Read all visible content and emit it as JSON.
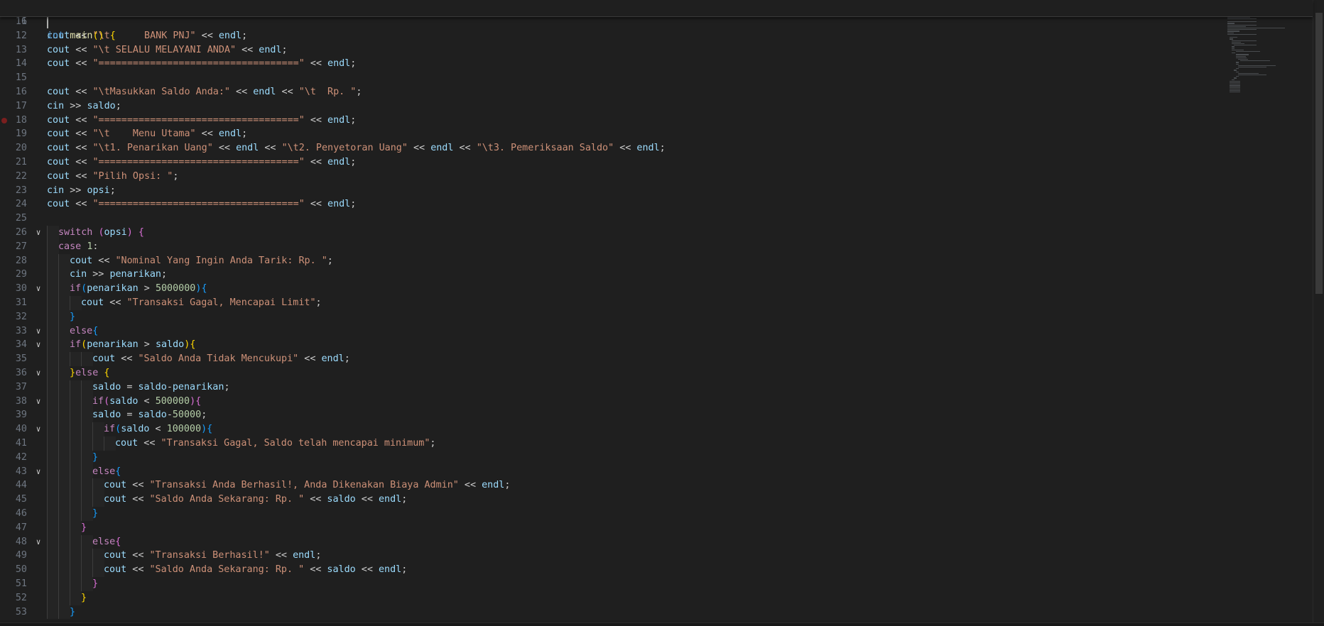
{
  "colors": {
    "background": "#1f1f1f",
    "line_number": "#6e7681",
    "keyword": "#569cd6",
    "control": "#c586c0",
    "function": "#dcdcaa",
    "string": "#ce9178",
    "number": "#b5cea8",
    "variable": "#9cdcfe",
    "plain": "#cccccc",
    "bracket_1": "#ffd700",
    "bracket_2": "#da70d6",
    "bracket_3": "#179fff"
  },
  "sticky_header": {
    "line_number": "6",
    "tokens": [
      {
        "t": "int",
        "c": "keyword"
      },
      {
        "t": " ",
        "c": "plain"
      },
      {
        "t": "main",
        "c": "function"
      },
      {
        "t": "()",
        "c": "bracket_1"
      },
      {
        "t": " ",
        "c": "plain"
      },
      {
        "t": "{",
        "c": "bracket_1"
      }
    ]
  },
  "lines": [
    {
      "n": "11",
      "indent": 0,
      "fold": false,
      "bp": false,
      "tokens": []
    },
    {
      "n": "12",
      "indent": 0,
      "fold": false,
      "bp": false,
      "tokens": [
        {
          "t": "cout",
          "c": "variable"
        },
        {
          "t": " << ",
          "c": "plain"
        },
        {
          "t": "\"\\t      BANK PNJ\"",
          "c": "string"
        },
        {
          "t": " << ",
          "c": "plain"
        },
        {
          "t": "endl",
          "c": "variable"
        },
        {
          "t": ";",
          "c": "plain"
        }
      ]
    },
    {
      "n": "13",
      "indent": 0,
      "fold": false,
      "bp": false,
      "tokens": [
        {
          "t": "cout",
          "c": "variable"
        },
        {
          "t": " << ",
          "c": "plain"
        },
        {
          "t": "\"\\t SELALU MELAYANI ANDA\"",
          "c": "string"
        },
        {
          "t": " << ",
          "c": "plain"
        },
        {
          "t": "endl",
          "c": "variable"
        },
        {
          "t": ";",
          "c": "plain"
        }
      ]
    },
    {
      "n": "14",
      "indent": 0,
      "fold": false,
      "bp": false,
      "tokens": [
        {
          "t": "cout",
          "c": "variable"
        },
        {
          "t": " << ",
          "c": "plain"
        },
        {
          "t": "\"===================================\"",
          "c": "string"
        },
        {
          "t": " << ",
          "c": "plain"
        },
        {
          "t": "endl",
          "c": "variable"
        },
        {
          "t": ";",
          "c": "plain"
        }
      ]
    },
    {
      "n": "15",
      "indent": 0,
      "fold": false,
      "bp": false,
      "tokens": []
    },
    {
      "n": "16",
      "indent": 0,
      "fold": false,
      "bp": false,
      "tokens": [
        {
          "t": "cout",
          "c": "variable"
        },
        {
          "t": " << ",
          "c": "plain"
        },
        {
          "t": "\"\\tMasukkan Saldo Anda:\"",
          "c": "string"
        },
        {
          "t": " << ",
          "c": "plain"
        },
        {
          "t": "endl",
          "c": "variable"
        },
        {
          "t": " << ",
          "c": "plain"
        },
        {
          "t": "\"\\t  Rp. \"",
          "c": "string"
        },
        {
          "t": ";",
          "c": "plain"
        }
      ]
    },
    {
      "n": "17",
      "indent": 0,
      "fold": false,
      "bp": false,
      "tokens": [
        {
          "t": "cin",
          "c": "variable"
        },
        {
          "t": " >> ",
          "c": "plain"
        },
        {
          "t": "saldo",
          "c": "variable"
        },
        {
          "t": ";",
          "c": "plain"
        }
      ]
    },
    {
      "n": "18",
      "indent": 0,
      "fold": false,
      "bp": true,
      "tokens": [
        {
          "t": "cout",
          "c": "variable"
        },
        {
          "t": " << ",
          "c": "plain"
        },
        {
          "t": "\"===================================\"",
          "c": "string"
        },
        {
          "t": " << ",
          "c": "plain"
        },
        {
          "t": "endl",
          "c": "variable"
        },
        {
          "t": ";",
          "c": "plain"
        }
      ]
    },
    {
      "n": "19",
      "indent": 0,
      "fold": false,
      "bp": false,
      "tokens": [
        {
          "t": "cout",
          "c": "variable"
        },
        {
          "t": " << ",
          "c": "plain"
        },
        {
          "t": "\"\\t    Menu Utama\"",
          "c": "string"
        },
        {
          "t": " << ",
          "c": "plain"
        },
        {
          "t": "endl",
          "c": "variable"
        },
        {
          "t": ";",
          "c": "plain"
        }
      ]
    },
    {
      "n": "20",
      "indent": 0,
      "fold": false,
      "bp": false,
      "tokens": [
        {
          "t": "cout",
          "c": "variable"
        },
        {
          "t": " << ",
          "c": "plain"
        },
        {
          "t": "\"\\t1. Penarikan Uang\"",
          "c": "string"
        },
        {
          "t": " << ",
          "c": "plain"
        },
        {
          "t": "endl",
          "c": "variable"
        },
        {
          "t": " << ",
          "c": "plain"
        },
        {
          "t": "\"\\t2. Penyetoran Uang\"",
          "c": "string"
        },
        {
          "t": " << ",
          "c": "plain"
        },
        {
          "t": "endl",
          "c": "variable"
        },
        {
          "t": " << ",
          "c": "plain"
        },
        {
          "t": "\"\\t3. Pemeriksaan Saldo\"",
          "c": "string"
        },
        {
          "t": " << ",
          "c": "plain"
        },
        {
          "t": "endl",
          "c": "variable"
        },
        {
          "t": ";",
          "c": "plain"
        }
      ]
    },
    {
      "n": "21",
      "indent": 0,
      "fold": false,
      "bp": false,
      "tokens": [
        {
          "t": "cout",
          "c": "variable"
        },
        {
          "t": " << ",
          "c": "plain"
        },
        {
          "t": "\"===================================\"",
          "c": "string"
        },
        {
          "t": " << ",
          "c": "plain"
        },
        {
          "t": "endl",
          "c": "variable"
        },
        {
          "t": ";",
          "c": "plain"
        }
      ]
    },
    {
      "n": "22",
      "indent": 0,
      "fold": false,
      "bp": false,
      "tokens": [
        {
          "t": "cout",
          "c": "variable"
        },
        {
          "t": " << ",
          "c": "plain"
        },
        {
          "t": "\"Pilih Opsi: \"",
          "c": "string"
        },
        {
          "t": ";",
          "c": "plain"
        }
      ]
    },
    {
      "n": "23",
      "indent": 0,
      "fold": false,
      "bp": false,
      "tokens": [
        {
          "t": "cin",
          "c": "variable"
        },
        {
          "t": " >> ",
          "c": "plain"
        },
        {
          "t": "opsi",
          "c": "variable"
        },
        {
          "t": ";",
          "c": "plain"
        }
      ]
    },
    {
      "n": "24",
      "indent": 0,
      "fold": false,
      "bp": false,
      "tokens": [
        {
          "t": "cout",
          "c": "variable"
        },
        {
          "t": " << ",
          "c": "plain"
        },
        {
          "t": "\"===================================\"",
          "c": "string"
        },
        {
          "t": " << ",
          "c": "plain"
        },
        {
          "t": "endl",
          "c": "variable"
        },
        {
          "t": ";",
          "c": "plain"
        }
      ]
    },
    {
      "n": "25",
      "indent": 0,
      "fold": false,
      "bp": false,
      "tokens": []
    },
    {
      "n": "26",
      "indent": 1,
      "fold": true,
      "bp": false,
      "tokens": [
        {
          "t": "switch",
          "c": "control"
        },
        {
          "t": " ",
          "c": "plain"
        },
        {
          "t": "(",
          "c": "bracket_2"
        },
        {
          "t": "opsi",
          "c": "variable"
        },
        {
          "t": ")",
          "c": "bracket_2"
        },
        {
          "t": " ",
          "c": "plain"
        },
        {
          "t": "{",
          "c": "bracket_2"
        }
      ]
    },
    {
      "n": "27",
      "indent": 1,
      "fold": false,
      "bp": false,
      "tokens": [
        {
          "t": "case",
          "c": "control"
        },
        {
          "t": " ",
          "c": "plain"
        },
        {
          "t": "1",
          "c": "number"
        },
        {
          "t": ":",
          "c": "plain"
        }
      ]
    },
    {
      "n": "28",
      "indent": 2,
      "fold": false,
      "bp": false,
      "tokens": [
        {
          "t": "cout",
          "c": "variable"
        },
        {
          "t": " << ",
          "c": "plain"
        },
        {
          "t": "\"Nominal Yang Ingin Anda Tarik: Rp. \"",
          "c": "string"
        },
        {
          "t": ";",
          "c": "plain"
        }
      ]
    },
    {
      "n": "29",
      "indent": 2,
      "fold": false,
      "bp": false,
      "tokens": [
        {
          "t": "cin",
          "c": "variable"
        },
        {
          "t": " >> ",
          "c": "plain"
        },
        {
          "t": "penarikan",
          "c": "variable"
        },
        {
          "t": ";",
          "c": "plain"
        }
      ]
    },
    {
      "n": "30",
      "indent": 2,
      "fold": true,
      "bp": false,
      "tokens": [
        {
          "t": "if",
          "c": "control"
        },
        {
          "t": "(",
          "c": "bracket_3"
        },
        {
          "t": "penarikan",
          "c": "variable"
        },
        {
          "t": " > ",
          "c": "plain"
        },
        {
          "t": "5000000",
          "c": "number"
        },
        {
          "t": ")",
          "c": "bracket_3"
        },
        {
          "t": "{",
          "c": "bracket_3"
        }
      ]
    },
    {
      "n": "31",
      "indent": 3,
      "fold": false,
      "bp": false,
      "tokens": [
        {
          "t": "cout",
          "c": "variable"
        },
        {
          "t": " << ",
          "c": "plain"
        },
        {
          "t": "\"Transaksi Gagal, Mencapai Limit\"",
          "c": "string"
        },
        {
          "t": ";",
          "c": "plain"
        }
      ]
    },
    {
      "n": "32",
      "indent": 2,
      "fold": false,
      "bp": false,
      "tokens": [
        {
          "t": "}",
          "c": "bracket_3"
        }
      ]
    },
    {
      "n": "33",
      "indent": 2,
      "fold": true,
      "bp": false,
      "tokens": [
        {
          "t": "else",
          "c": "control"
        },
        {
          "t": "{",
          "c": "bracket_3"
        }
      ]
    },
    {
      "n": "34",
      "indent": 2,
      "fold": true,
      "bp": false,
      "tokens": [
        {
          "t": "if",
          "c": "control"
        },
        {
          "t": "(",
          "c": "bracket_1"
        },
        {
          "t": "penarikan",
          "c": "variable"
        },
        {
          "t": " > ",
          "c": "plain"
        },
        {
          "t": "saldo",
          "c": "variable"
        },
        {
          "t": ")",
          "c": "bracket_1"
        },
        {
          "t": "{",
          "c": "bracket_1"
        }
      ]
    },
    {
      "n": "35",
      "indent": 4,
      "fold": false,
      "bp": false,
      "tokens": [
        {
          "t": "cout",
          "c": "variable"
        },
        {
          "t": " << ",
          "c": "plain"
        },
        {
          "t": "\"Saldo Anda Tidak Mencukupi\"",
          "c": "string"
        },
        {
          "t": " << ",
          "c": "plain"
        },
        {
          "t": "endl",
          "c": "variable"
        },
        {
          "t": ";",
          "c": "plain"
        }
      ]
    },
    {
      "n": "36",
      "indent": 2,
      "fold": true,
      "bp": false,
      "tokens": [
        {
          "t": "}",
          "c": "bracket_1"
        },
        {
          "t": "else",
          "c": "control"
        },
        {
          "t": " ",
          "c": "plain"
        },
        {
          "t": "{",
          "c": "bracket_1"
        }
      ]
    },
    {
      "n": "37",
      "indent": 4,
      "fold": false,
      "bp": false,
      "tokens": [
        {
          "t": "saldo",
          "c": "variable"
        },
        {
          "t": " = ",
          "c": "plain"
        },
        {
          "t": "saldo",
          "c": "variable"
        },
        {
          "t": "-",
          "c": "plain"
        },
        {
          "t": "penarikan",
          "c": "variable"
        },
        {
          "t": ";",
          "c": "plain"
        }
      ]
    },
    {
      "n": "38",
      "indent": 4,
      "fold": true,
      "bp": false,
      "tokens": [
        {
          "t": "if",
          "c": "control"
        },
        {
          "t": "(",
          "c": "bracket_2"
        },
        {
          "t": "saldo",
          "c": "variable"
        },
        {
          "t": " < ",
          "c": "plain"
        },
        {
          "t": "500000",
          "c": "number"
        },
        {
          "t": ")",
          "c": "bracket_2"
        },
        {
          "t": "{",
          "c": "bracket_2"
        }
      ]
    },
    {
      "n": "39",
      "indent": 4,
      "fold": false,
      "bp": false,
      "tokens": [
        {
          "t": "saldo",
          "c": "variable"
        },
        {
          "t": " = ",
          "c": "plain"
        },
        {
          "t": "saldo",
          "c": "variable"
        },
        {
          "t": "-",
          "c": "plain"
        },
        {
          "t": "50000",
          "c": "number"
        },
        {
          "t": ";",
          "c": "plain"
        }
      ]
    },
    {
      "n": "40",
      "indent": 5,
      "fold": true,
      "bp": false,
      "tokens": [
        {
          "t": "if",
          "c": "control"
        },
        {
          "t": "(",
          "c": "bracket_3"
        },
        {
          "t": "saldo",
          "c": "variable"
        },
        {
          "t": " < ",
          "c": "plain"
        },
        {
          "t": "100000",
          "c": "number"
        },
        {
          "t": ")",
          "c": "bracket_3"
        },
        {
          "t": "{",
          "c": "bracket_3"
        }
      ]
    },
    {
      "n": "41",
      "indent": 6,
      "fold": false,
      "bp": false,
      "tokens": [
        {
          "t": "cout",
          "c": "variable"
        },
        {
          "t": " << ",
          "c": "plain"
        },
        {
          "t": "\"Transaksi Gagal, Saldo telah mencapai minimum\"",
          "c": "string"
        },
        {
          "t": ";",
          "c": "plain"
        }
      ]
    },
    {
      "n": "42",
      "indent": 4,
      "fold": false,
      "bp": false,
      "tokens": [
        {
          "t": "}",
          "c": "bracket_3"
        }
      ]
    },
    {
      "n": "43",
      "indent": 4,
      "fold": true,
      "bp": false,
      "tokens": [
        {
          "t": "else",
          "c": "control"
        },
        {
          "t": "{",
          "c": "bracket_3"
        }
      ]
    },
    {
      "n": "44",
      "indent": 5,
      "fold": false,
      "bp": false,
      "tokens": [
        {
          "t": "cout",
          "c": "variable"
        },
        {
          "t": " << ",
          "c": "plain"
        },
        {
          "t": "\"Transaksi Anda Berhasil!, Anda Dikenakan Biaya Admin\"",
          "c": "string"
        },
        {
          "t": " << ",
          "c": "plain"
        },
        {
          "t": "endl",
          "c": "variable"
        },
        {
          "t": ";",
          "c": "plain"
        }
      ]
    },
    {
      "n": "45",
      "indent": 5,
      "fold": false,
      "bp": false,
      "tokens": [
        {
          "t": "cout",
          "c": "variable"
        },
        {
          "t": " << ",
          "c": "plain"
        },
        {
          "t": "\"Saldo Anda Sekarang: Rp. \"",
          "c": "string"
        },
        {
          "t": " << ",
          "c": "plain"
        },
        {
          "t": "saldo",
          "c": "variable"
        },
        {
          "t": " << ",
          "c": "plain"
        },
        {
          "t": "endl",
          "c": "variable"
        },
        {
          "t": ";",
          "c": "plain"
        }
      ]
    },
    {
      "n": "46",
      "indent": 4,
      "fold": false,
      "bp": false,
      "tokens": [
        {
          "t": "}",
          "c": "bracket_3"
        }
      ]
    },
    {
      "n": "47",
      "indent": 3,
      "fold": false,
      "bp": false,
      "tokens": [
        {
          "t": "}",
          "c": "bracket_2"
        }
      ]
    },
    {
      "n": "48",
      "indent": 4,
      "fold": true,
      "bp": false,
      "tokens": [
        {
          "t": "else",
          "c": "control"
        },
        {
          "t": "{",
          "c": "bracket_2"
        }
      ]
    },
    {
      "n": "49",
      "indent": 5,
      "fold": false,
      "bp": false,
      "tokens": [
        {
          "t": "cout",
          "c": "variable"
        },
        {
          "t": " << ",
          "c": "plain"
        },
        {
          "t": "\"Transaksi Berhasil!\"",
          "c": "string"
        },
        {
          "t": " << ",
          "c": "plain"
        },
        {
          "t": "endl",
          "c": "variable"
        },
        {
          "t": ";",
          "c": "plain"
        }
      ]
    },
    {
      "n": "50",
      "indent": 5,
      "fold": false,
      "bp": false,
      "tokens": [
        {
          "t": "cout",
          "c": "variable"
        },
        {
          "t": " << ",
          "c": "plain"
        },
        {
          "t": "\"Saldo Anda Sekarang: Rp. \"",
          "c": "string"
        },
        {
          "t": " << ",
          "c": "plain"
        },
        {
          "t": "saldo",
          "c": "variable"
        },
        {
          "t": " << ",
          "c": "plain"
        },
        {
          "t": "endl",
          "c": "variable"
        },
        {
          "t": ";",
          "c": "plain"
        }
      ]
    },
    {
      "n": "51",
      "indent": 4,
      "fold": false,
      "bp": false,
      "tokens": [
        {
          "t": "}",
          "c": "bracket_2"
        }
      ]
    },
    {
      "n": "52",
      "indent": 3,
      "fold": false,
      "bp": false,
      "tokens": [
        {
          "t": "}",
          "c": "bracket_1"
        }
      ]
    },
    {
      "n": "53",
      "indent": 2,
      "fold": false,
      "bp": false,
      "tokens": [
        {
          "t": "}",
          "c": "bracket_3"
        }
      ]
    }
  ]
}
